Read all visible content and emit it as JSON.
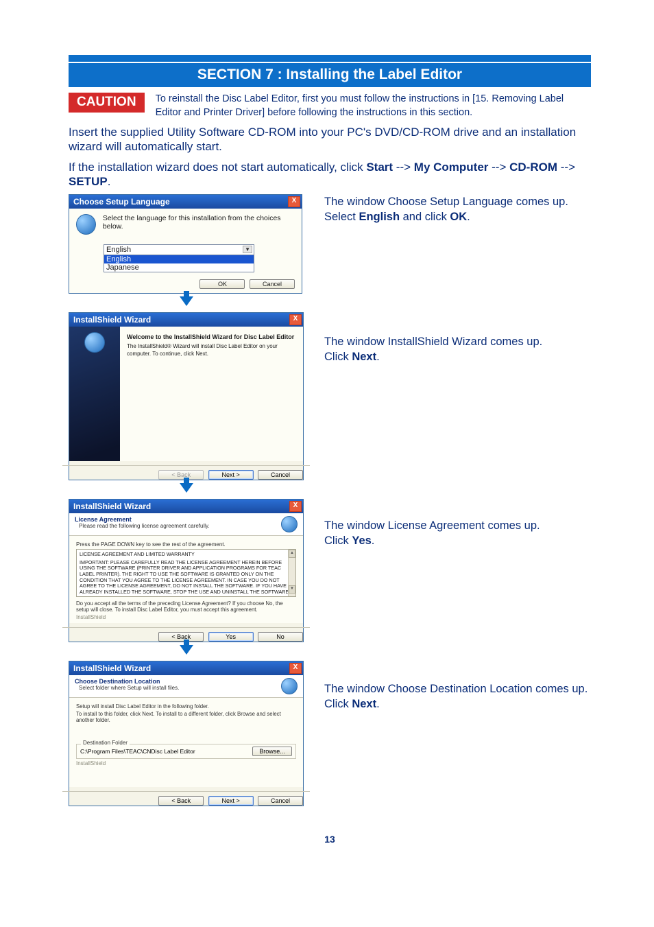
{
  "section_bar": "SECTION 7 :  Installing the Label Editor",
  "caution_label": "CAUTION",
  "caution_text": "To reinstall the Disc Label Editor, first you must follow the instructions in [15. Removing Label Editor and Printer Driver] before following the instructions in this section.",
  "para1": "Insert the supplied Utility Software CD-ROM into your PC's DVD/CD-ROM drive and an installation wizard will automatically start.",
  "para2_pre": "If the installation wizard does not start automatically, click ",
  "para2_b1": "Start",
  "para2_arrow": " --> ",
  "para2_b2": "My Computer",
  "para2_b3": "CD-ROM",
  "para2_b4": "SETUP",
  "period": ".",
  "step1": {
    "line1": "The window Choose Setup Language comes up.",
    "line2_pre": "Select ",
    "line2_b1": "English",
    "line2_mid": " and click ",
    "line2_b2": "OK",
    "title": "Choose Setup Language",
    "prompt": "Select the language for this installation from the choices below.",
    "combo_value": "English",
    "options": [
      "English",
      "Japanese"
    ],
    "ok": "OK",
    "cancel": "Cancel"
  },
  "step2": {
    "line1": "The window InstallShield Wizard comes up.",
    "line2_pre": "Click ",
    "line2_b": "Next",
    "title": "InstallShield Wizard",
    "wtitle": "Welcome to the InstallShield Wizard for Disc Label Editor",
    "wtext": "The InstallShield® Wizard will install Disc Label Editor on your computer.  To continue, click Next.",
    "back": "< Back",
    "next": "Next >",
    "cancel": "Cancel"
  },
  "step3": {
    "line1": "The window License Agreement comes up.",
    "line2_pre": "Click ",
    "line2_b": "Yes",
    "title": "InstallShield Wizard",
    "htitle": "License Agreement",
    "hsub": "Please read the following license agreement carefully.",
    "press": "Press the PAGE DOWN key to see the rest of the agreement.",
    "lic_head": "LICENSE AGREEMENT AND LIMITED WARRANTY",
    "lic_body": "IMPORTANT:  PLEASE CAREFULLY READ THE LICENSE AGREEMENT HEREIN BEFORE USING THE SOFTWARE (PRINTER DRIVER AND APPLICATION PROGRAMS FOR TEAC LABEL PRINTER). THE RIGHT TO USE THE SOFTWARE IS GRANTED ONLY ON THE CONDITION THAT YOU AGREE TO THE LICENSE AGREEMENT. IN CASE YOU DO NOT AGREE TO THE LICENSE AGREEMENT, DO NOT INSTALL THE SOFTWARE. IF YOU HAVE ALREADY INSTALLED THE SOFTWARE, STOP THE USE AND UNINSTALL THE SOFTWARE. IF YOU DO NOT AGREE TO THE LICENSE AGREEMENT, YOU MAY RETURN THE WHOLE",
    "question": "Do you accept all the terms of the preceding License Agreement?  If you choose No, the setup will close.  To install Disc Label Editor, you must accept this agreement.",
    "back": "< Back",
    "yes": "Yes",
    "no": "No"
  },
  "step4": {
    "line1": "The window Choose Destination Location comes up.",
    "line2_pre": "Click ",
    "line2_b": "Next",
    "title": "InstallShield Wizard",
    "htitle": "Choose Destination Location",
    "hsub": "Select folder where Setup will install files.",
    "instr1": "Setup will install Disc Label Editor in the following folder.",
    "instr2": "To install to this folder, click Next. To install to a different folder, click Browse and select another folder.",
    "dest_legend": "Destination Folder",
    "dest_path": "C:\\Program Files\\TEAC\\CNDisc Label Editor",
    "browse": "Browse...",
    "back": "< Back",
    "next": "Next >",
    "cancel": "Cancel"
  },
  "page_number": "13",
  "close_x": "X"
}
